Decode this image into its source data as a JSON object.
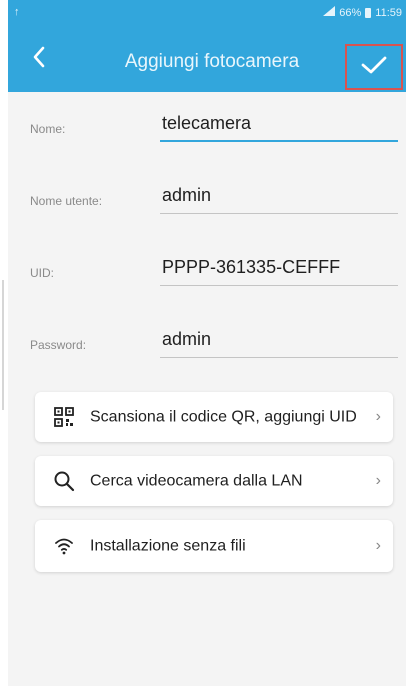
{
  "status_bar": {
    "left_indicator": "↑",
    "signal_text": "⁵⁵ᵢₗ",
    "battery_text": "66%",
    "time": "11:59"
  },
  "app_bar": {
    "title": "Aggiungi fotocamera",
    "back_icon": "chevron-left-icon",
    "confirm_icon": "check-icon"
  },
  "colors": {
    "primary": "#32a6dc",
    "highlight_border": "#d9534f",
    "background": "#f4f4f4"
  },
  "form": {
    "name": {
      "label": "Nome:",
      "value": "telecamera"
    },
    "username": {
      "label": "Nome utente:",
      "value": "admin"
    },
    "uid": {
      "label": "UID:",
      "value": "PPPP-361335-CEFFF"
    },
    "password": {
      "label": "Password:",
      "value": "admin"
    }
  },
  "actions": [
    {
      "label": "Scansiona il codice QR, aggiungi UID",
      "icon": "qr-code-icon"
    },
    {
      "label": "Cerca videocamera dalla LAN",
      "icon": "search-icon"
    },
    {
      "label": "Installazione senza fili",
      "icon": "wifi-icon"
    }
  ],
  "chevron": "›"
}
